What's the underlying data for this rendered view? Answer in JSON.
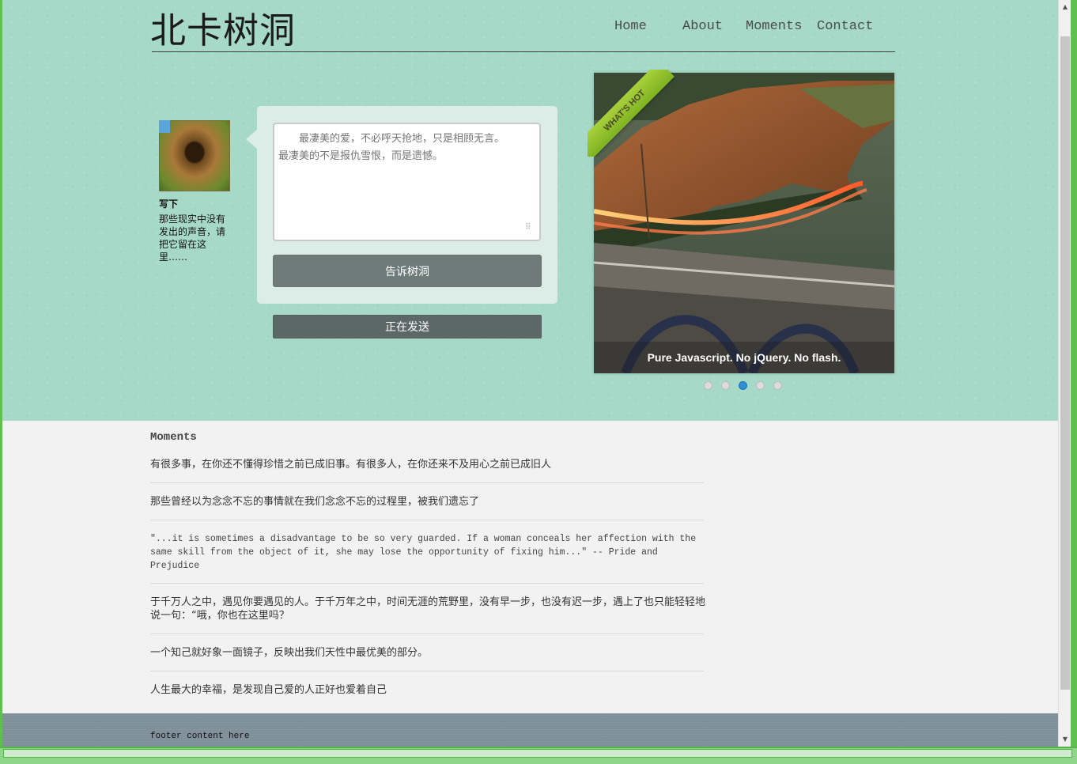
{
  "site": {
    "title": "北卡树洞"
  },
  "nav": {
    "items": [
      {
        "label": "Home"
      },
      {
        "label": "About"
      },
      {
        "label": "Moments"
      },
      {
        "label": "Contact"
      }
    ]
  },
  "sidebar": {
    "title": "写下",
    "text": "那些现实中没有发出的声音，请把它留在这里……"
  },
  "compose": {
    "placeholder": "　　最凄美的爱，不必呼天抢地，只是相顾无言。\n最凄美的不是报仇雪恨，而是遗憾。",
    "submit_label": "告诉树洞",
    "sending_label": "正在发送"
  },
  "slider": {
    "ribbon": "WHAT'S HOT",
    "caption": "Pure Javascript. No jQuery. No flash.",
    "dot_count": 5,
    "active_index": 2
  },
  "moments": {
    "title": "Moments",
    "items": [
      "有很多事，在你还不懂得珍惜之前已成旧事。有很多人，在你还来不及用心之前已成旧人",
      "那些曾经以为念念不忘的事情就在我们念念不忘的过程里，被我们遗忘了",
      "\"...it is sometimes a disadvantage to be so very guarded. If a woman conceals her affection with the same skill from the object of it, she may lose the opportunity of fixing him...\" -- Pride and Prejudice",
      "于千万人之中，遇见你要遇见的人。于千万年之中，时间无涯的荒野里，没有早一步，也没有迟一步，遇上了也只能轻轻地说一句：“哦，你也在这里吗？",
      "一个知己就好象一面镜子，反映出我们天性中最优美的部分。",
      "人生最大的幸福，是发现自己爱的人正好也爱着自己"
    ]
  },
  "footer": {
    "text": "footer content here"
  }
}
